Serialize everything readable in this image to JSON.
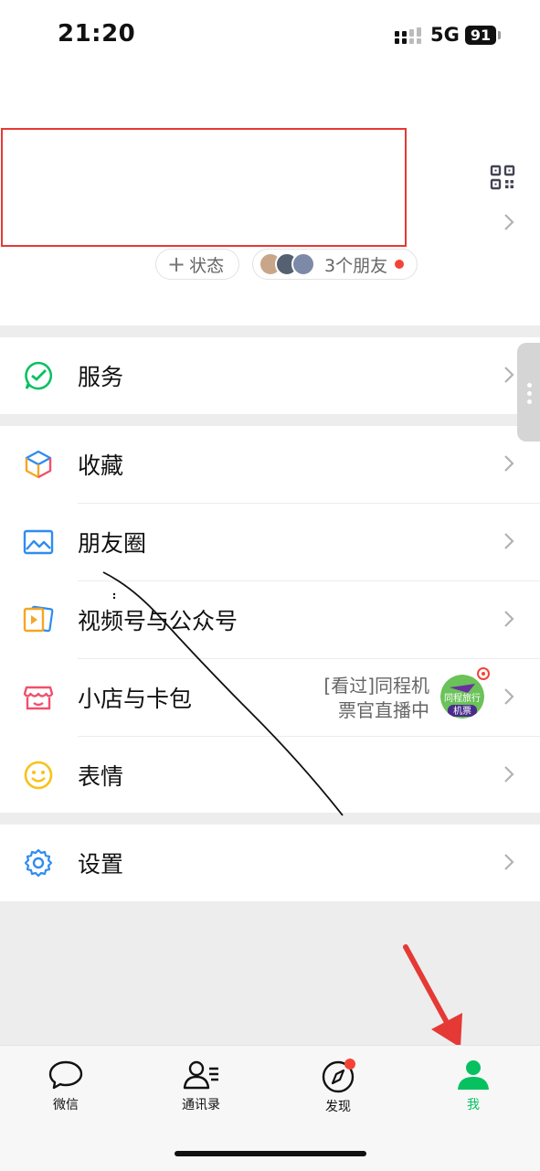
{
  "status_bar": {
    "time": "21:20",
    "network": "5G",
    "battery": "91"
  },
  "profile": {
    "status_pill": "状态",
    "friends_pill": "3个朋友",
    "friend_avatar_colors": [
      "#c9a68a",
      "#556070",
      "#7c8aa8"
    ]
  },
  "menu": {
    "service": "服务",
    "favorites": "收藏",
    "moments": "朋友圈",
    "channels": "视频号与公众号",
    "shop": "小店与卡包",
    "shop_extra_line1": "[看过]同程机",
    "shop_extra_line2": "票官直播中",
    "shop_badge_top": "同程旅行",
    "shop_badge_bottom": "机票",
    "stickers": "表情",
    "settings": "设置"
  },
  "tabbar": {
    "chats": "微信",
    "contacts": "通讯录",
    "discover": "发现",
    "me": "我"
  },
  "colors": {
    "accent": "#07c160",
    "annotation_red": "#e53935",
    "badge_red": "#f44336"
  },
  "icons": [
    "qr-code-icon",
    "chevron-right-icon",
    "service-check-icon",
    "favorites-cube-icon",
    "moments-image-icon",
    "channels-play-icon",
    "shop-icon",
    "smile-icon",
    "gear-icon",
    "chat-bubble-icon",
    "contacts-icon",
    "compass-icon",
    "person-icon"
  ]
}
